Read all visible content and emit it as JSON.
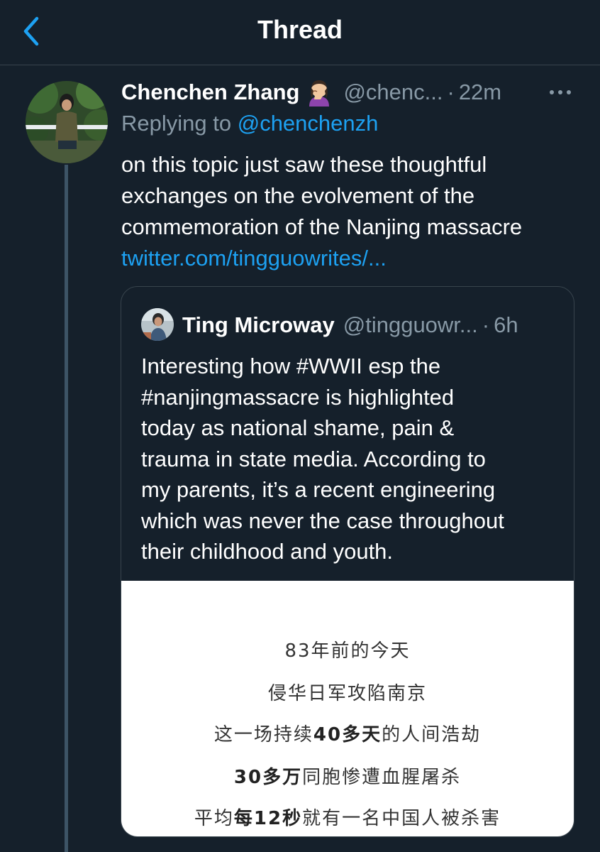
{
  "header": {
    "title": "Thread"
  },
  "tweet": {
    "author_name": "Chenchen Zhang",
    "author_handle": "@chenc...",
    "dot": "·",
    "time": "22m",
    "replying_prefix": "Replying to",
    "replying_handle": "@chenchenzh",
    "body_lines": [
      "on this topic just saw these thoughtful",
      "exchanges on the evolvement of the",
      "commemoration of the Nanjing massacre"
    ],
    "link": "twitter.com/tingguowrites/..."
  },
  "quote": {
    "author_name": "Ting Microway",
    "author_handle": "@tingguowr...",
    "dot": "·",
    "time": "6h",
    "body_lines": [
      "Interesting how #WWII esp the",
      "#nanjingmassacre is highlighted",
      "today as national shame, pain &",
      "trauma in state media. According to",
      "my parents, it’s a recent engineering",
      "which was never the case throughout",
      "their childhood and youth."
    ],
    "media": {
      "line1": "83年前的今天",
      "line2": "侵华日军攻陷南京",
      "line3_a": "这一场持续",
      "line3_b": "40多天",
      "line3_c": "的人间浩劫",
      "line4_a": "30多万",
      "line4_b": "同胞惨遭血腥屠杀",
      "line5_a": "平均",
      "line5_b": "每12秒",
      "line5_c": "就有一名中国人被杀害"
    }
  },
  "colors": {
    "background": "#15202b",
    "accent": "#1da1f2",
    "secondary_text": "#8899a6",
    "border": "#38444d"
  },
  "icons": {
    "back": "chevron-left-icon",
    "more": "more-horizontal-icon",
    "emoji": "facepalm-emoji-icon"
  }
}
